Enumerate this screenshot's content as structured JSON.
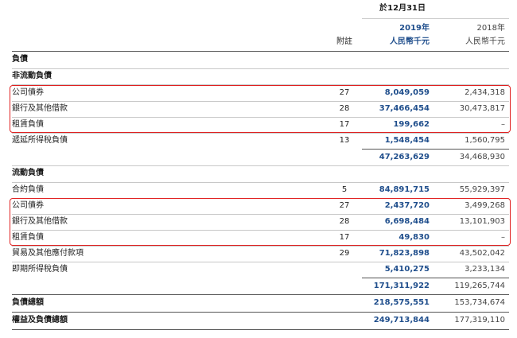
{
  "header": {
    "date": "於12月31日",
    "col_note": "附註",
    "col_2019_year": "2019年",
    "col_2018_year": "2018年",
    "col_2019_unit": "人民幣千元",
    "col_2018_unit": "人民幣千元"
  },
  "sections": {
    "liabilities": "負債",
    "non_current": "非流動負債",
    "current": "流動負債"
  },
  "non_current_rows": [
    {
      "label": "公司債券",
      "note": "27",
      "v2019": "8,049,059",
      "v2018": "2,434,318"
    },
    {
      "label": "銀行及其他借款",
      "note": "28",
      "v2019": "37,466,454",
      "v2018": "30,473,817"
    },
    {
      "label": "租賃負債",
      "note": "17",
      "v2019": "199,662",
      "v2018": "–"
    },
    {
      "label": "遞延所得稅負債",
      "note": "13",
      "v2019": "1,548,454",
      "v2018": "1,560,795"
    }
  ],
  "non_current_subtotal": {
    "v2019": "47,263,629",
    "v2018": "34,468,930"
  },
  "current_rows": [
    {
      "label": "合約負債",
      "note": "5",
      "v2019": "84,891,715",
      "v2018": "55,929,397"
    },
    {
      "label": "公司債券",
      "note": "27",
      "v2019": "2,437,720",
      "v2018": "3,499,268"
    },
    {
      "label": "銀行及其他借款",
      "note": "28",
      "v2019": "6,698,484",
      "v2018": "13,101,903"
    },
    {
      "label": "租賃負債",
      "note": "17",
      "v2019": "49,830",
      "v2018": "–"
    },
    {
      "label": "貿易及其他應付款項",
      "note": "29",
      "v2019": "71,823,898",
      "v2018": "43,502,042"
    },
    {
      "label": "即期所得稅負債",
      "note": "",
      "v2019": "5,410,275",
      "v2018": "3,233,134"
    }
  ],
  "current_subtotal": {
    "v2019": "171,311,922",
    "v2018": "119,265,744"
  },
  "total_liabilities": {
    "label": "負債總額",
    "v2019": "218,575,551",
    "v2018": "153,734,674"
  },
  "total_equity_liabilities": {
    "label": "權益及負債總額",
    "v2019": "249,713,844",
    "v2018": "177,319,110"
  },
  "colors": {
    "accent": "#1f4e8c",
    "highlight_box": "#e02020"
  }
}
